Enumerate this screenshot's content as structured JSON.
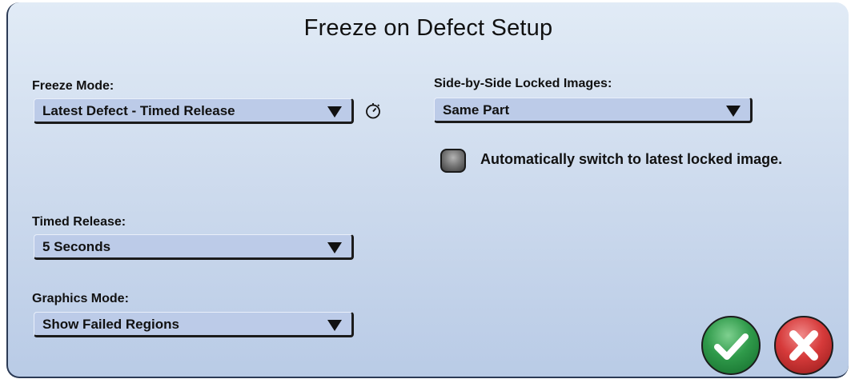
{
  "dialog": {
    "title": "Freeze on Defect Setup"
  },
  "freeze_mode": {
    "label": "Freeze Mode:",
    "value": "Latest Defect - Timed Release",
    "icon": "stopwatch-icon"
  },
  "side_by_side": {
    "label": "Side-by-Side Locked Images:",
    "value": "Same Part"
  },
  "auto_switch": {
    "label": "Automatically switch to latest locked image.",
    "checked": false
  },
  "timed_release": {
    "label": "Timed Release:",
    "value": "5 Seconds"
  },
  "graphics_mode": {
    "label": "Graphics Mode:",
    "value": "Show Failed Regions"
  },
  "buttons": {
    "ok_icon": "checkmark-icon",
    "cancel_icon": "x-icon"
  },
  "colors": {
    "ok": "#2f9a4a",
    "cancel": "#d63a3a",
    "dropdown_bg": "#bccbe8"
  }
}
